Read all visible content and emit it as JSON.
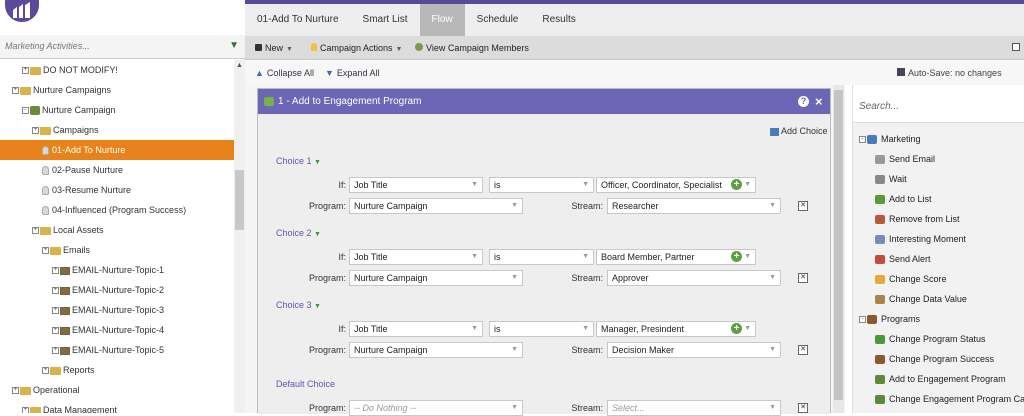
{
  "tabs": [
    "01-Add To Nurture",
    "Smart List",
    "Flow",
    "Schedule",
    "Results"
  ],
  "active_tab": "Flow",
  "sidebar": {
    "search_placeholder": "Marketing Activities...",
    "tree": [
      {
        "label": "DO NOT MODIFY!",
        "indent": 1,
        "kind": "folder"
      },
      {
        "label": "Nurture Campaigns",
        "indent": 0,
        "kind": "folder"
      },
      {
        "label": "Nurture Campaign",
        "indent": 1,
        "kind": "program"
      },
      {
        "label": "Campaigns",
        "indent": 2,
        "kind": "folder"
      },
      {
        "label": "01-Add To Nurture",
        "indent": 3,
        "kind": "bulb",
        "selected": true
      },
      {
        "label": "02-Pause Nurture",
        "indent": 3,
        "kind": "bulb"
      },
      {
        "label": "03-Resume Nurture",
        "indent": 3,
        "kind": "bulb"
      },
      {
        "label": "04-Influenced (Program Success)",
        "indent": 3,
        "kind": "bulb"
      },
      {
        "label": "Local Assets",
        "indent": 2,
        "kind": "folder"
      },
      {
        "label": "Emails",
        "indent": 3,
        "kind": "folder"
      },
      {
        "label": "EMAIL-Nurture-Topic-1",
        "indent": 4,
        "kind": "email"
      },
      {
        "label": "EMAIL-Nurture-Topic-2",
        "indent": 4,
        "kind": "email"
      },
      {
        "label": "EMAIL-Nurture-Topic-3",
        "indent": 4,
        "kind": "email"
      },
      {
        "label": "EMAIL-Nurture-Topic-4",
        "indent": 4,
        "kind": "email"
      },
      {
        "label": "EMAIL-Nurture-Topic-5",
        "indent": 4,
        "kind": "email"
      },
      {
        "label": "Reports",
        "indent": 3,
        "kind": "folder"
      },
      {
        "label": "Operational",
        "indent": 0,
        "kind": "folder"
      },
      {
        "label": "Data Management",
        "indent": 1,
        "kind": "folder"
      }
    ]
  },
  "toolbar": {
    "new_label": "New",
    "campaign_actions_label": "Campaign Actions",
    "view_members_label": "View Campaign Members"
  },
  "subbar": {
    "collapse_label": "Collapse All",
    "expand_label": "Expand All",
    "autosave_label": "Auto-Save: no changes"
  },
  "flow_step": {
    "title": "1 - Add to Engagement Program",
    "add_choice_label": "Add Choice",
    "if_label": "If:",
    "program_label": "Program:",
    "stream_label": "Stream:",
    "choices": [
      {
        "label": "Choice 1",
        "field": "Job Title",
        "operator": "is",
        "value": "Officer, Coordinator, Specialist",
        "program": "Nurture Campaign",
        "stream": "Researcher"
      },
      {
        "label": "Choice 2",
        "field": "Job Title",
        "operator": "is",
        "value": "Board Member, Partner",
        "program": "Nurture Campaign",
        "stream": "Approver"
      },
      {
        "label": "Choice 3",
        "field": "Job Title",
        "operator": "is",
        "value": "Manager, Presindent",
        "program": "Nurture Campaign",
        "stream": "Decision Maker"
      }
    ],
    "default_choice": {
      "label": "Default Choice",
      "program_placeholder": "-- Do Nothing --",
      "stream_placeholder": "Select..."
    }
  },
  "palette": {
    "search_placeholder": "Search...",
    "items": [
      {
        "label": "Marketing",
        "group": true,
        "color": "#4a7ab8"
      },
      {
        "label": "Send Email",
        "color": "#9a9a9a"
      },
      {
        "label": "Wait",
        "color": "#888888"
      },
      {
        "label": "Add to List",
        "color": "#5a9a3a"
      },
      {
        "label": "Remove from List",
        "color": "#b85a3a"
      },
      {
        "label": "Interesting Moment",
        "color": "#7a8ab8"
      },
      {
        "label": "Send Alert",
        "color": "#c84a3a"
      },
      {
        "label": "Change Score",
        "color": "#e8a83a"
      },
      {
        "label": "Change Data Value",
        "color": "#a8844a"
      },
      {
        "label": "Programs",
        "group": true,
        "color": "#8b5a2a"
      },
      {
        "label": "Change Program Status",
        "color": "#4a9a3a"
      },
      {
        "label": "Change Program Success",
        "color": "#8b5a2a"
      },
      {
        "label": "Add to Engagement Program",
        "color": "#5a8a3a"
      },
      {
        "label": "Change Engagement Program Cad",
        "color": "#5a8a3a"
      }
    ]
  }
}
